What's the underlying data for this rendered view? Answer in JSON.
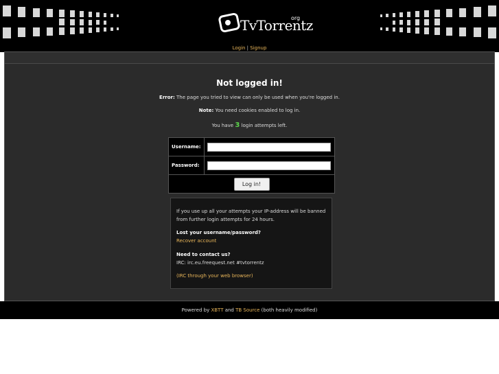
{
  "header": {
    "logo_text": "TvTorrentz",
    "logo_suffix": "org"
  },
  "topnav": {
    "login": "Login",
    "separator": " | ",
    "signup": "Signup"
  },
  "main": {
    "title": "Not logged in!",
    "error_label": "Error:",
    "error_text": " The page you tried to view can only be used when you're logged in.",
    "note_label": "Note:",
    "note_text": " You need cookies enabled to log in.",
    "attempts_prefix": "You have ",
    "attempts_count": "3",
    "attempts_suffix": " login attempts left."
  },
  "form": {
    "username_label": "Username:",
    "username_value": "",
    "password_label": "Password:",
    "password_value": "",
    "submit_label": "Log in!"
  },
  "info": {
    "ban_warning": "If you use up all your attempts your IP-address will be banned from further login attempts for 24 hours.",
    "lost_heading": "Lost your username/password?",
    "recover_link": "Recover account",
    "contact_heading": "Need to contact us?",
    "irc_text": "IRC: irc.eu.freequest.net #tvtorrentz",
    "irc_web_open": "(",
    "irc_web_link": "IRC through your web browser",
    "irc_web_close": ")"
  },
  "footer": {
    "prefix": "Powered by ",
    "xbtt": "XBTT",
    "and": " and ",
    "tbsource": "TB Source",
    "suffix": " (both heavily modified)"
  }
}
